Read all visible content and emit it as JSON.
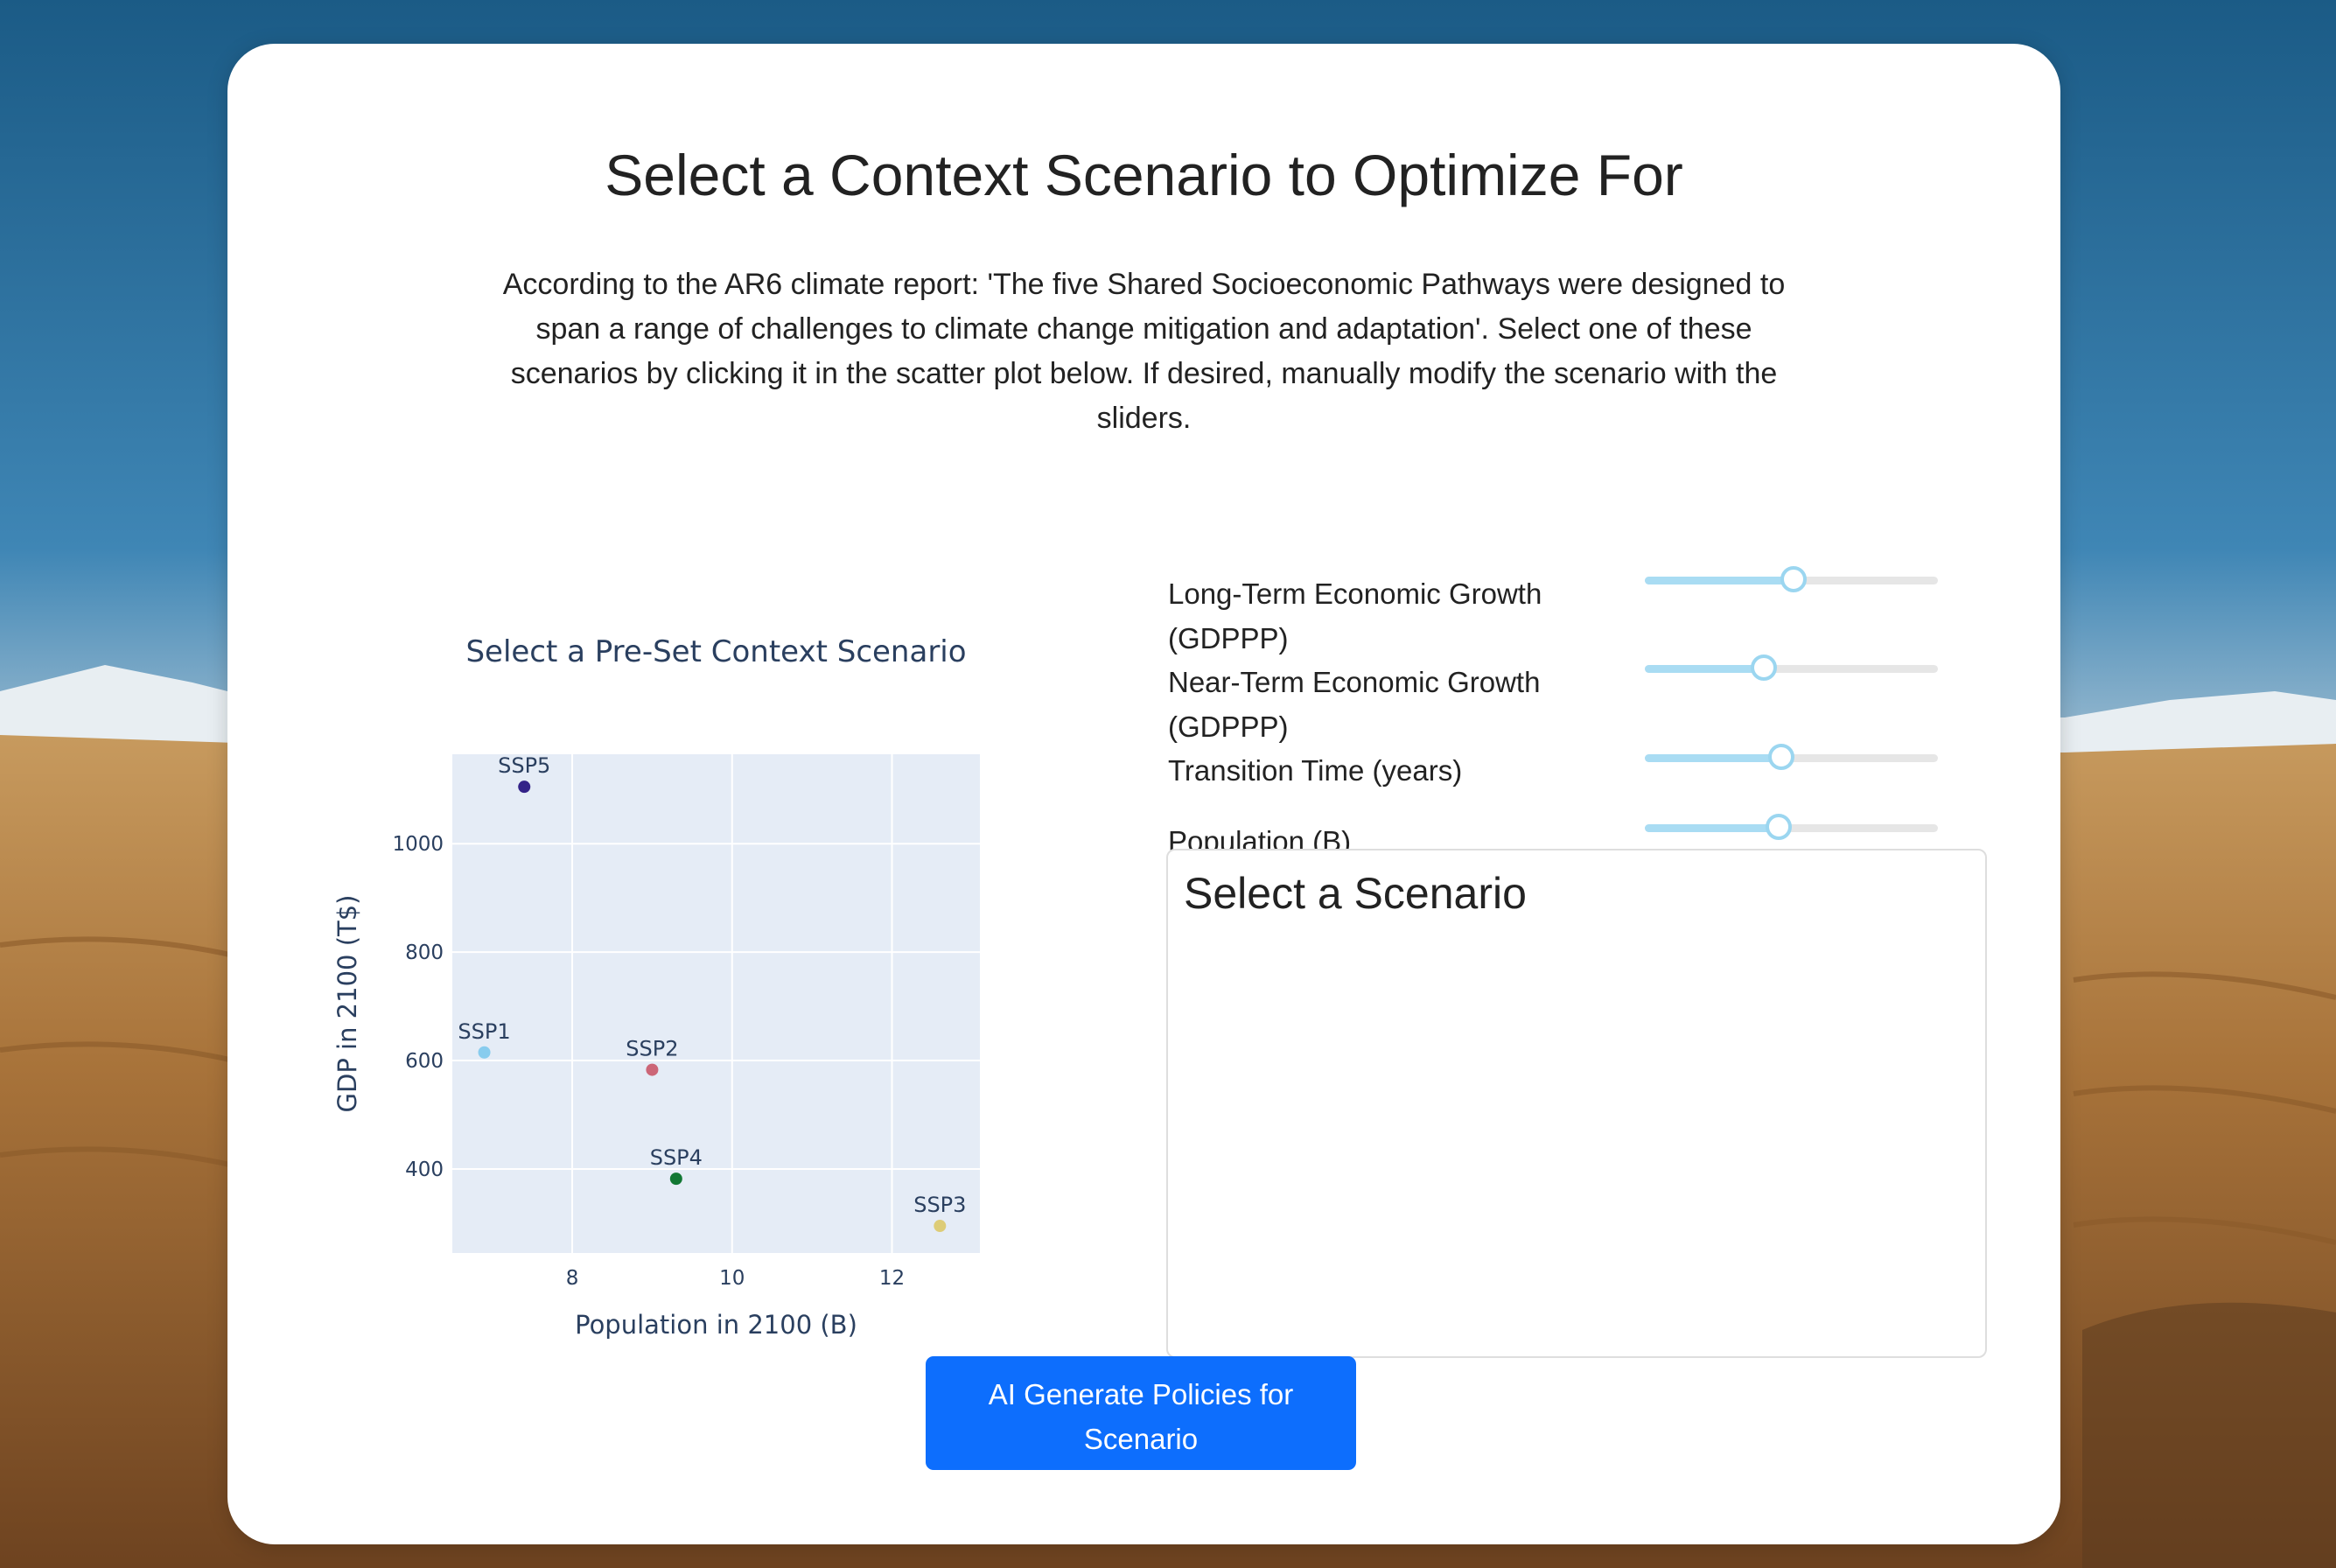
{
  "page": {
    "title": "Select a Context Scenario to Optimize For",
    "intro": "According to the AR6 climate report: 'The five Shared Socioeconomic Pathways were designed to span a range of challenges to climate change mitigation and adaptation'. Select one of these scenarios by clicking it in the scatter plot below. If desired, manually modify the scenario with the sliders."
  },
  "chart_data": {
    "type": "scatter",
    "title": "Select a Pre-Set Context Scenario",
    "xlabel": "Population in 2100 (B)",
    "ylabel": "GDP in 2100 (T$)",
    "xlim": [
      6.5,
      13.1
    ],
    "ylim": [
      245,
      1165
    ],
    "xticks": [
      8,
      10,
      12
    ],
    "yticks": [
      400,
      600,
      800,
      1000
    ],
    "grid": true,
    "points": [
      {
        "label": "SSP1",
        "x": 6.9,
        "y": 615,
        "color": "#88ccee"
      },
      {
        "label": "SSP2",
        "x": 9.0,
        "y": 583,
        "color": "#cc6677"
      },
      {
        "label": "SSP3",
        "x": 12.6,
        "y": 295,
        "color": "#ddcc77"
      },
      {
        "label": "SSP4",
        "x": 9.3,
        "y": 382,
        "color": "#117733"
      },
      {
        "label": "SSP5",
        "x": 7.4,
        "y": 1105,
        "color": "#332288"
      }
    ]
  },
  "sliders": [
    {
      "label": "Long-Term Economic Growth (GDPPP)",
      "value_fraction": 0.5
    },
    {
      "label": "Near-Term Economic Growth (GDPPP)",
      "value_fraction": 0.4
    },
    {
      "label": "Transition Time (years)",
      "value_fraction": 0.46
    },
    {
      "label": "Population (B)",
      "value_fraction": 0.45
    }
  ],
  "scenario_panel": {
    "heading": "Select a Scenario"
  },
  "actions": {
    "generate_label": "AI Generate Policies for Scenario"
  },
  "colors": {
    "accent": "#0d6efd",
    "slider": "#a9dcf3",
    "plot_bg": "#e5ecf6",
    "axis_text": "#2a3f5f"
  }
}
